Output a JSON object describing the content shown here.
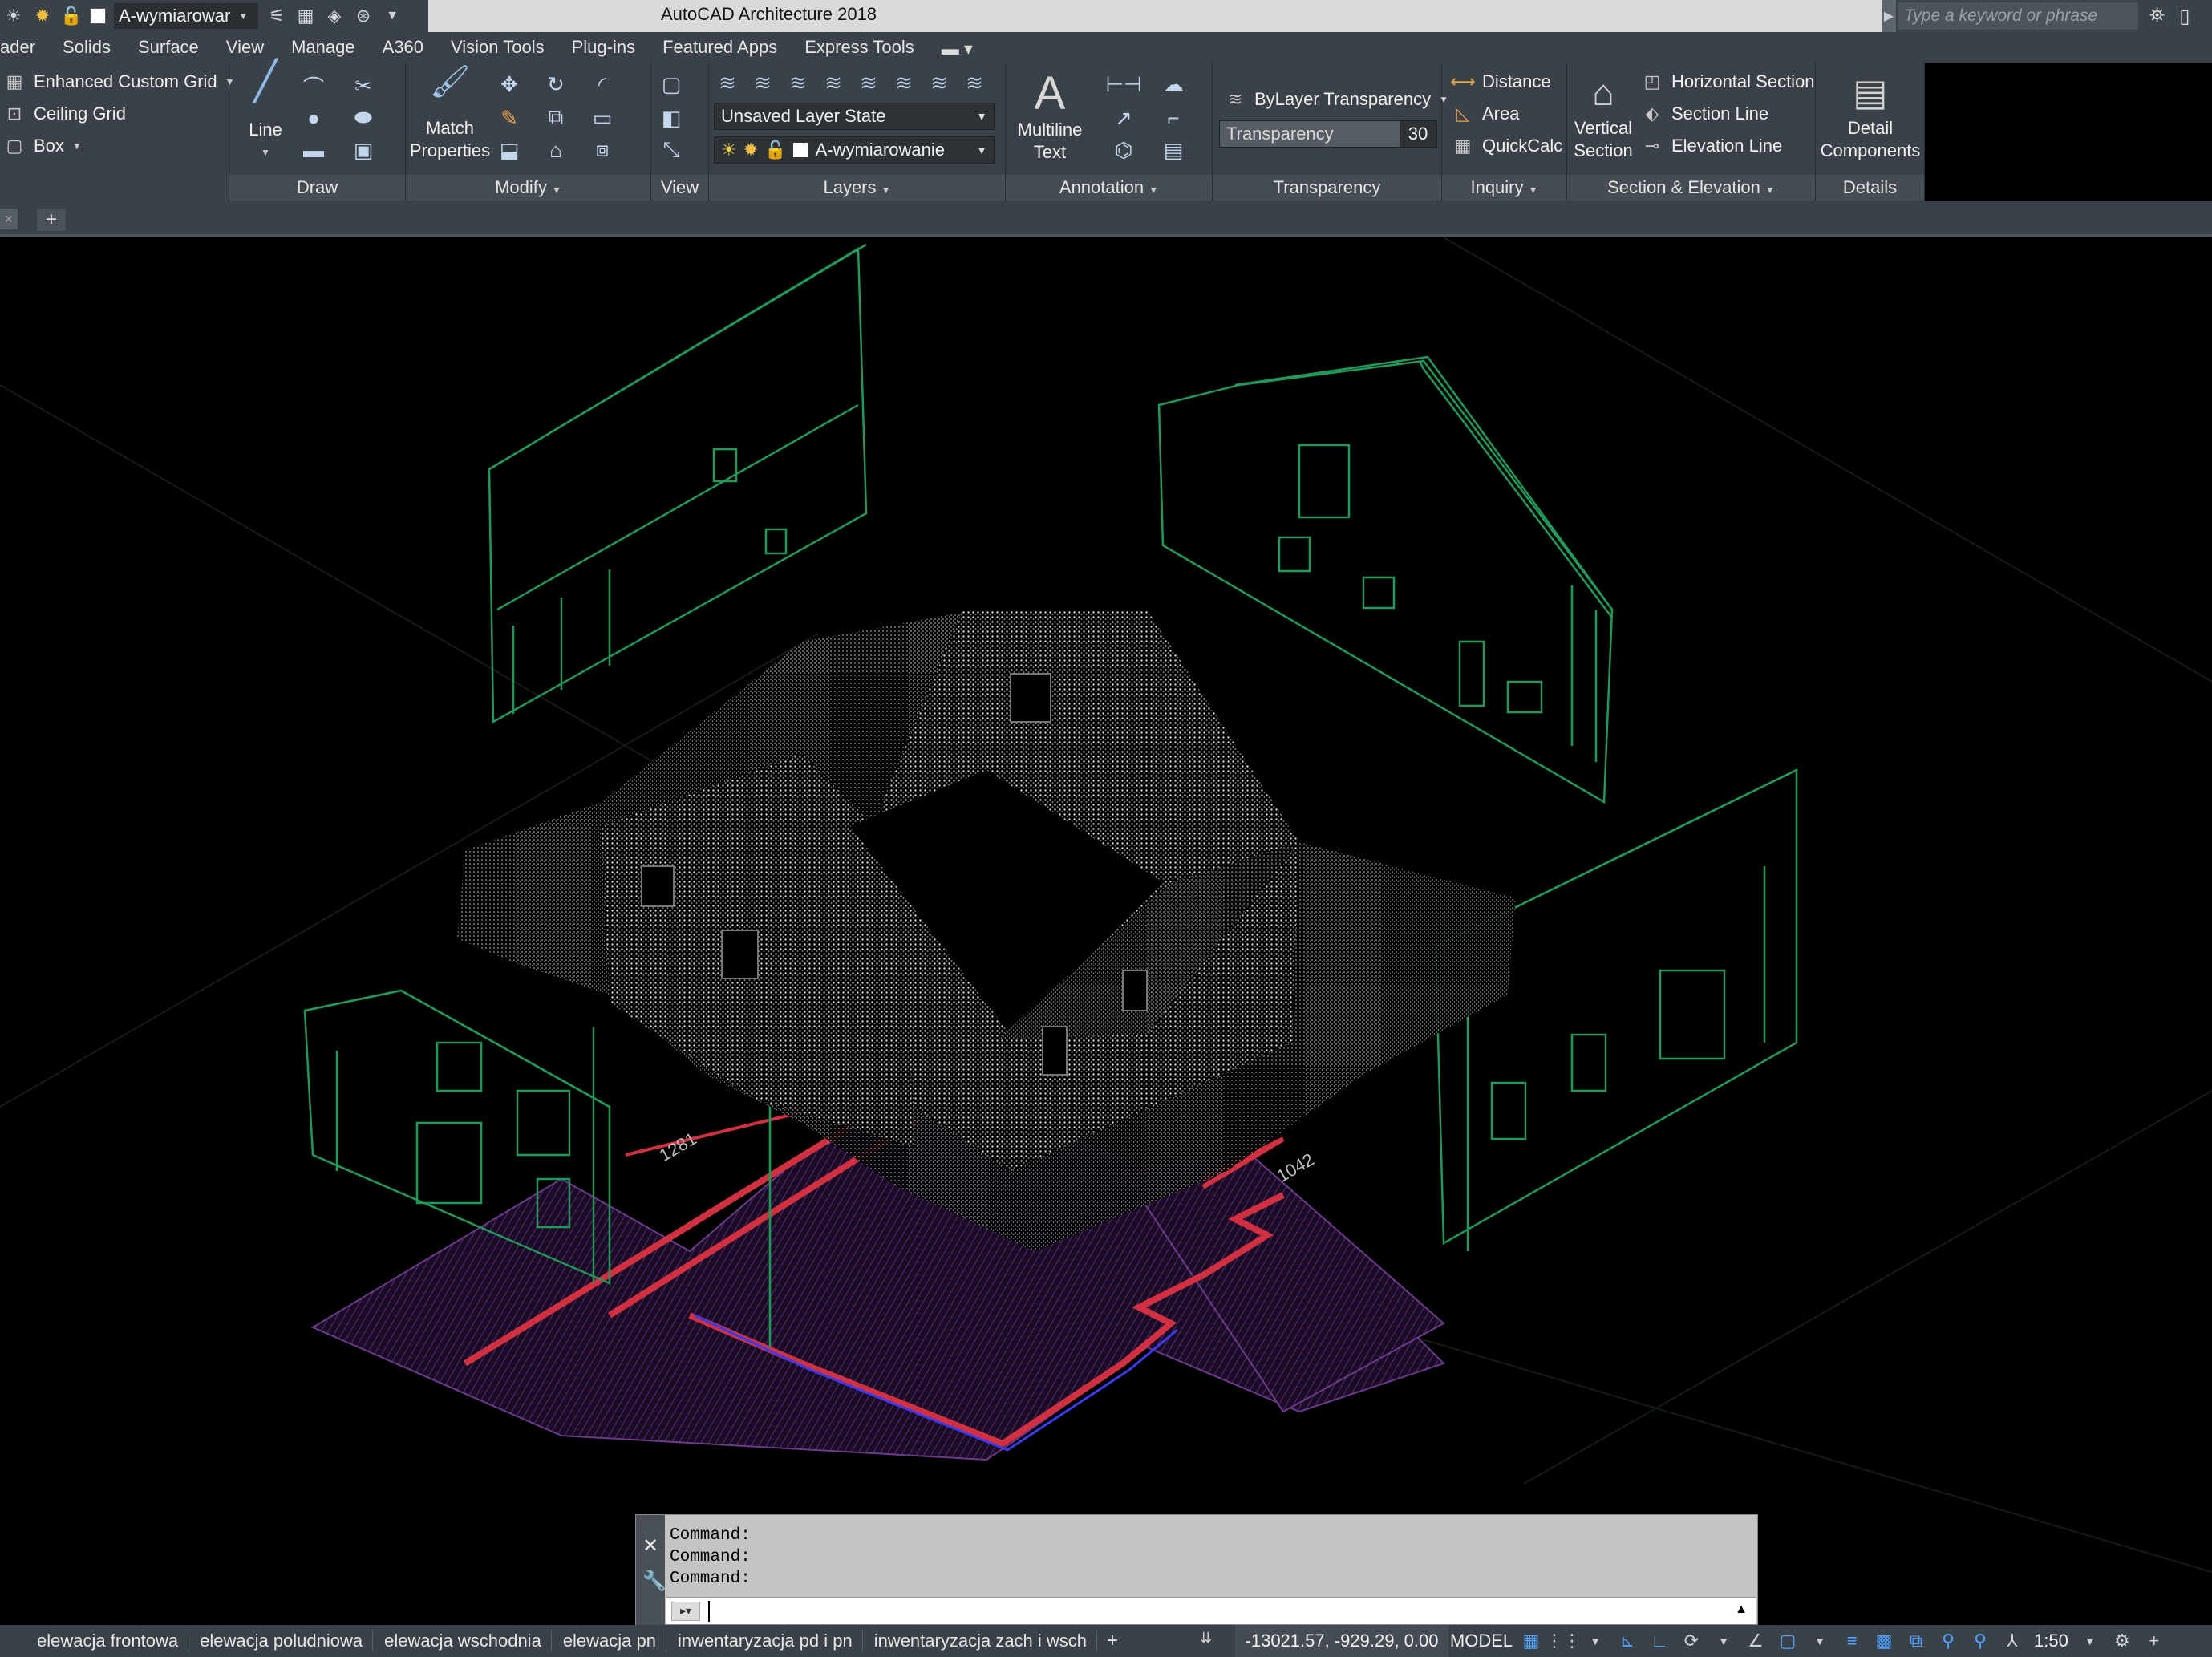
{
  "titlebar": {
    "current_layer": "A-wymiarowar",
    "app_title": "AutoCAD Architecture 2018",
    "search_placeholder": "Type a keyword or phrase"
  },
  "menu_tabs": [
    "ader",
    "Solids",
    "Surface",
    "View",
    "Manage",
    "A360",
    "Vision Tools",
    "Plug-ins",
    "Featured Apps",
    "Express Tools"
  ],
  "ribbon": {
    "grid_panel": {
      "enhanced_custom_grid": "Enhanced Custom Grid",
      "ceiling_grid": "Ceiling Grid",
      "box": "Box"
    },
    "draw": {
      "line": "Line",
      "label": "Draw"
    },
    "modify": {
      "match_properties_1": "Match",
      "match_properties_2": "Properties",
      "label": "Modify"
    },
    "view": {
      "label": "View"
    },
    "layers": {
      "layer_state": "Unsaved Layer State",
      "current_layer": "A-wymiarowanie",
      "label": "Layers"
    },
    "annotation": {
      "multiline_1": "Multiline",
      "multiline_2": "Text",
      "label": "Annotation"
    },
    "transparency": {
      "bylayer": "ByLayer Transparency",
      "field_label": "Transparency",
      "value": "30",
      "label": "Transparency"
    },
    "inquiry": {
      "distance": "Distance",
      "area": "Area",
      "quickcalc": "QuickCalc",
      "label": "Inquiry"
    },
    "section": {
      "vertical_1": "Vertical",
      "vertical_2": "Section",
      "horizontal": "Horizontal Section",
      "section_line": "Section Line",
      "elevation_line": "Elevation Line",
      "label": "Section & Elevation"
    },
    "details": {
      "detail_1": "Detail",
      "detail_2": "Components",
      "label": "Details"
    }
  },
  "drawing": {
    "dimension_1": "1281",
    "dimension_2": "1042"
  },
  "command_line": {
    "history": [
      "Command:",
      "Command:",
      "Command:"
    ]
  },
  "status_bar": {
    "layout_tabs": [
      "elewacja frontowa",
      "elewacja poludniowa",
      "elewacja wschodnia",
      "elewacja pn",
      "inwentaryzacja pd i pn",
      "inwentaryzacja zach i wsch"
    ],
    "coordinates": "-13021.57, -929.29, 0.00",
    "space": "MODEL",
    "scale": "1:50"
  },
  "colors": {
    "ui_dark": "#3b4148",
    "cad_green": "#1f9a5a",
    "floor_purple": "#5a2a7a",
    "wall_red": "#d23040"
  }
}
